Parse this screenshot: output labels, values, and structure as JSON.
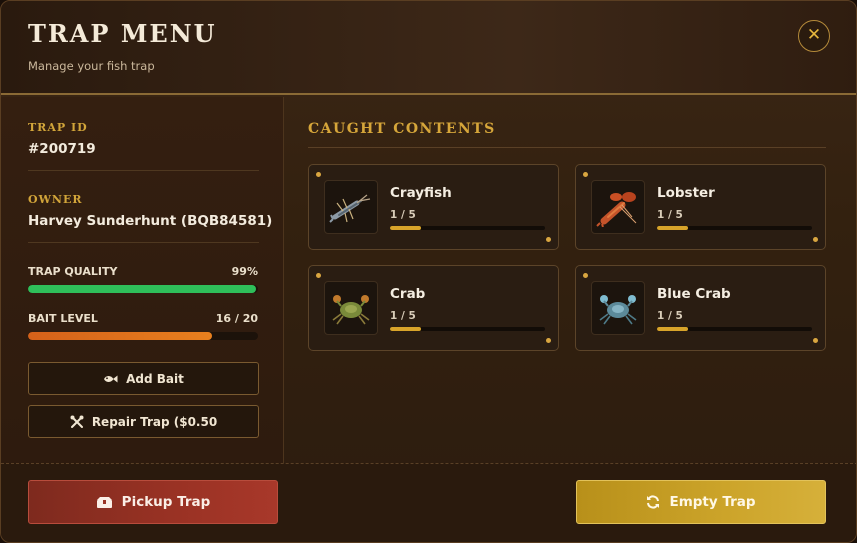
{
  "header": {
    "title": "TRAP MENU",
    "subtitle": "Manage your fish trap",
    "close_icon": "close-icon",
    "close_glyph": "✕"
  },
  "sidebar": {
    "trap_id_label": "TRAP ID",
    "trap_id": "#200719",
    "owner_label": "OWNER",
    "owner": "Harvey Sunderhunt (BQB84581)",
    "quality_label": "TRAP QUALITY",
    "quality_value": "99%",
    "quality_fraction": 0.99,
    "bait_label": "BAIT LEVEL",
    "bait_value": "16 / 20",
    "bait_fraction": 0.8,
    "add_bait_label": "Add Bait",
    "add_bait_icon": "fish-icon",
    "repair_label": "Repair Trap ($0.50",
    "repair_icon": "wrench-screwdriver-icon"
  },
  "contents": {
    "title": "CAUGHT CONTENTS",
    "items": [
      {
        "name": "Crayfish",
        "count": "1 / 5",
        "fraction": 0.2,
        "icon": "crayfish-icon"
      },
      {
        "name": "Lobster",
        "count": "1 / 5",
        "fraction": 0.2,
        "icon": "lobster-icon"
      },
      {
        "name": "Crab",
        "count": "1 / 5",
        "fraction": 0.2,
        "icon": "crab-icon"
      },
      {
        "name": "Blue Crab",
        "count": "1 / 5",
        "fraction": 0.2,
        "icon": "blue-crab-icon"
      }
    ]
  },
  "footer": {
    "pickup_label": "Pickup Trap",
    "pickup_icon": "box-icon",
    "empty_label": "Empty Trap",
    "empty_icon": "refresh-icon"
  },
  "colors": {
    "accent_gold": "#d6a63a",
    "quality_green": "#2fbf5a",
    "bait_orange": "#e2701c",
    "pickup_red": "#9a3224",
    "empty_gold": "#cca42a"
  }
}
